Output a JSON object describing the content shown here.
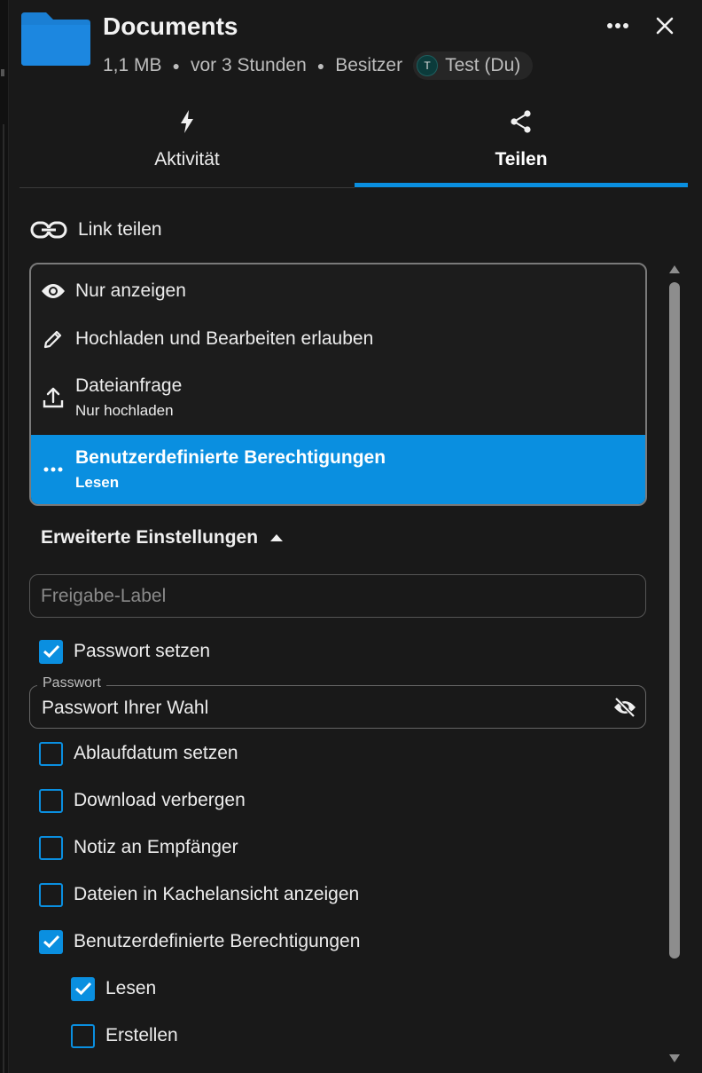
{
  "header": {
    "title": "Documents",
    "size": "1,1 MB",
    "modified": "vor 3 Stunden",
    "owner_label": "Besitzer",
    "owner_initial": "T",
    "owner_name": "Test (Du)",
    "folder_color": "#1a7fd4"
  },
  "tabs": [
    {
      "label": "Aktivität",
      "icon": "lightning-icon",
      "active": false
    },
    {
      "label": "Teilen",
      "icon": "share-icon",
      "active": true
    }
  ],
  "link_share": {
    "label": "Link teilen",
    "icon": "link-icon"
  },
  "permission_menu": {
    "items": [
      {
        "label": "Nur anzeigen",
        "sub": "",
        "icon": "eye-icon"
      },
      {
        "label": "Hochladen und Bearbeiten erlauben",
        "sub": "",
        "icon": "pencil-icon"
      },
      {
        "label": "Dateianfrage",
        "sub": "Nur hochladen",
        "icon": "upload-icon"
      },
      {
        "label": "Benutzerdefinierte Berechtigungen",
        "sub": "Lesen",
        "icon": "more-icon",
        "selected": true
      }
    ]
  },
  "advanced": {
    "header": "Erweiterte Einstellungen",
    "share_label_placeholder": "Freigabe-Label",
    "set_password": {
      "label": "Passwort setzen",
      "checked": true
    },
    "password": {
      "legend": "Passwort",
      "value": "Passwort Ihrer Wahl"
    },
    "options": [
      {
        "label": "Ablaufdatum setzen",
        "checked": false
      },
      {
        "label": "Download verbergen",
        "checked": false
      },
      {
        "label": "Notiz an Empfänger",
        "checked": false
      },
      {
        "label": "Dateien in Kachelansicht anzeigen",
        "checked": false
      },
      {
        "label": "Benutzerdefinierte Berechtigungen",
        "checked": true
      }
    ],
    "custom_permissions": [
      {
        "label": "Lesen",
        "checked": true
      },
      {
        "label": "Erstellen",
        "checked": false
      }
    ]
  },
  "colors": {
    "accent": "#0a8fe0",
    "background": "#191919"
  }
}
